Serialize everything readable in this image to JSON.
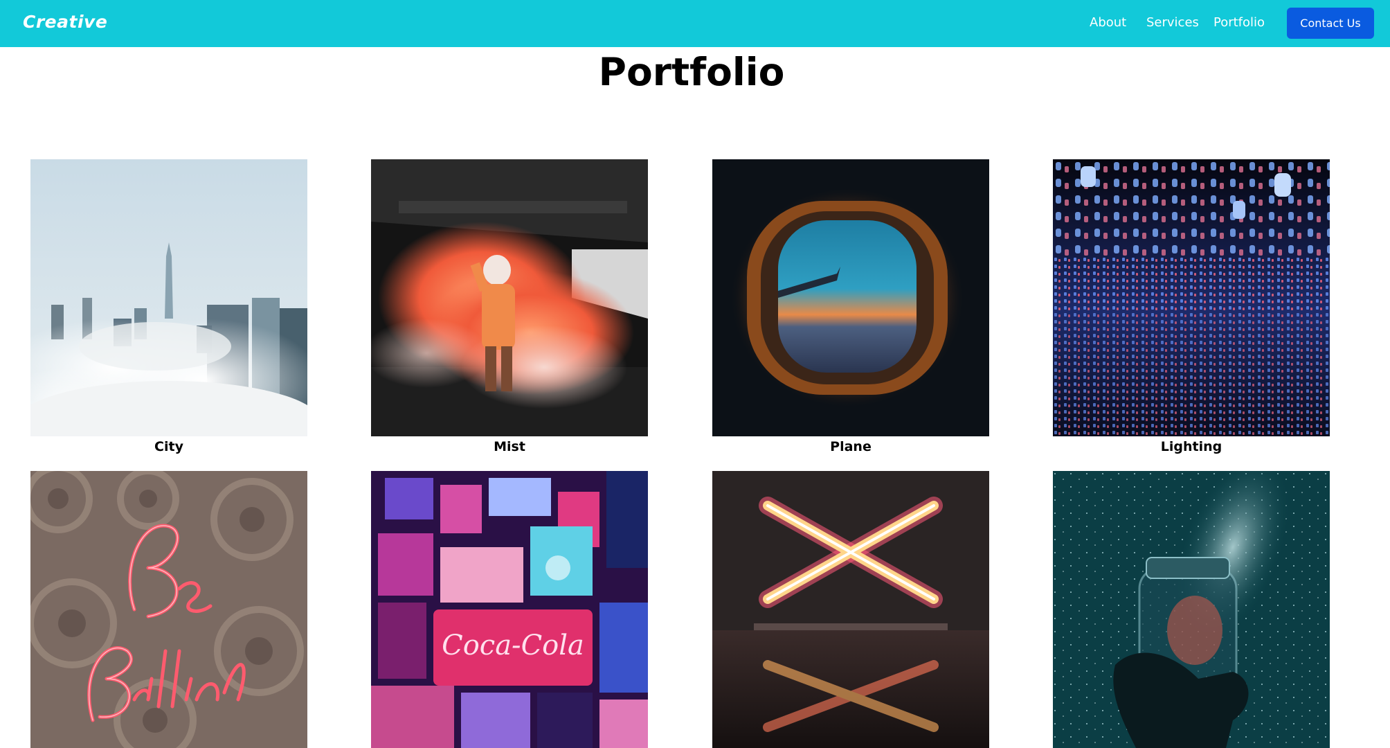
{
  "navbar": {
    "brand": "Creative",
    "links": [
      {
        "label": "About"
      },
      {
        "label": "Services"
      },
      {
        "label": "Portfolio"
      }
    ],
    "cta_label": "Contact Us",
    "colors": {
      "bar": "#12c9d9",
      "cta": "#0a5be0"
    }
  },
  "main": {
    "title": "Portfolio",
    "items": [
      {
        "caption": "City",
        "image": "city-in-clouds"
      },
      {
        "caption": "Mist",
        "image": "person-with-orange-smoke"
      },
      {
        "caption": "Plane",
        "image": "airplane-window-sunset"
      },
      {
        "caption": "Lighting",
        "image": "floating-lanterns"
      },
      {
        "caption": "",
        "image": "neon-be-brilliant-sign"
      },
      {
        "caption": "",
        "image": "neon-coca-cola-signs-room"
      },
      {
        "caption": "",
        "image": "neon-x-sign"
      },
      {
        "caption": "",
        "image": "jar-of-stars"
      }
    ]
  }
}
